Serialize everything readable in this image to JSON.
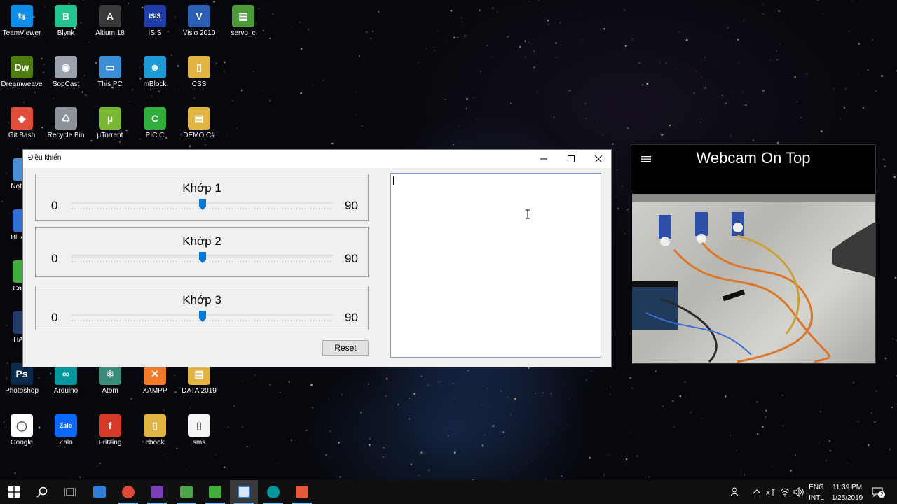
{
  "desktop": {
    "icons": [
      {
        "label": "TeamViewer",
        "color": "#0e8ee9",
        "glyph": "⇆"
      },
      {
        "label": "Blynk",
        "color": "#23c48e",
        "glyph": "B"
      },
      {
        "label": "Altium 18",
        "color": "#3a3a3a",
        "glyph": "A"
      },
      {
        "label": "ISIS",
        "color": "#1f3ea8",
        "glyph": "ISIS"
      },
      {
        "label": "Visio 2010",
        "color": "#2b5fb4",
        "glyph": "V"
      },
      {
        "label": "servo_c",
        "color": "#4c9a3a",
        "glyph": "▤"
      },
      {
        "label": "Dreamweave",
        "color": "#4d7c0f",
        "glyph": "Dw"
      },
      {
        "label": "SopCast",
        "color": "#9aa3ad",
        "glyph": "◉"
      },
      {
        "label": "This PC",
        "color": "#3c8fd6",
        "glyph": "▭"
      },
      {
        "label": "mBlock",
        "color": "#1e9ad6",
        "glyph": "☻"
      },
      {
        "label": "CSS",
        "color": "#e2b443",
        "glyph": "▯"
      },
      {
        "label": "Git Bash",
        "color": "#e24c3a",
        "glyph": "◆"
      },
      {
        "label": "Recycle Bin",
        "color": "#8c9399",
        "glyph": "♺"
      },
      {
        "label": "µTorrent",
        "color": "#78b833",
        "glyph": "µ"
      },
      {
        "label": "PIC C",
        "color": "#2fae3a",
        "glyph": "C"
      },
      {
        "label": "DEMO C#",
        "color": "#e2b443",
        "glyph": "▤"
      },
      {
        "label": "Photoshop",
        "color": "#0b2a4a",
        "glyph": "Ps"
      },
      {
        "label": "Arduino",
        "color": "#00979c",
        "glyph": "∞"
      },
      {
        "label": "Atom",
        "color": "#3a8b7a",
        "glyph": "⚛"
      },
      {
        "label": "XAMPP",
        "color": "#f27b2a",
        "glyph": "✕"
      },
      {
        "label": "DATA 2019",
        "color": "#e2b443",
        "glyph": "▤"
      },
      {
        "label": "Google",
        "color": "#ffffff",
        "glyph": "◯"
      },
      {
        "label": "Zalo",
        "color": "#0a68ff",
        "glyph": "Zalo"
      },
      {
        "label": "Fritzing",
        "color": "#d63b2a",
        "glyph": "f"
      },
      {
        "label": "ebook",
        "color": "#e2b443",
        "glyph": "▯"
      },
      {
        "label": "sms",
        "color": "#f4f4f4",
        "glyph": "▯"
      }
    ],
    "partial_icons": [
      "Notep",
      "BlueS",
      "Camt",
      "TIA P"
    ]
  },
  "control_window": {
    "title": "Điều khiển",
    "joints": [
      {
        "label": "Khớp 1",
        "min": "0",
        "max": "90",
        "value": 45,
        "range": 90
      },
      {
        "label": "Khớp 2",
        "min": "0",
        "max": "90",
        "value": 45,
        "range": 90
      },
      {
        "label": "Khớp 3",
        "min": "0",
        "max": "90",
        "value": 45,
        "range": 90
      }
    ],
    "reset_label": "Reset",
    "log_text": ""
  },
  "webcam_window": {
    "title": "Webcam On Top"
  },
  "taskbar": {
    "language_top": "ENG",
    "language_bottom": "INTL",
    "time": "11:39 PM",
    "date": "1/25/2019",
    "notifications": "2"
  },
  "colors": {
    "accent": "#0078d7",
    "thumb": "#0078d7"
  }
}
